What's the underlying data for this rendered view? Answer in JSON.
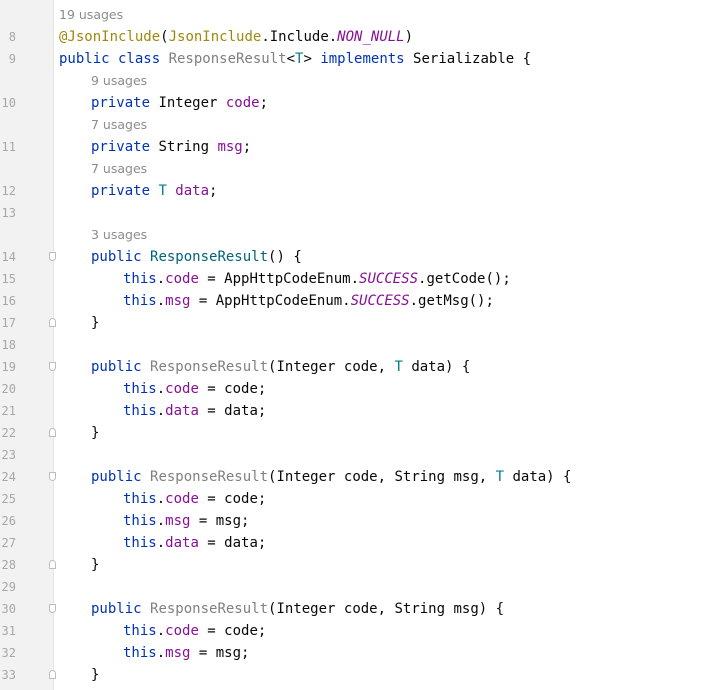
{
  "editor": {
    "lines": [
      {
        "kind": "hint",
        "indent": 0,
        "text": "19 usages"
      },
      {
        "kind": "code",
        "num": "8",
        "indent": 0,
        "tokens": [
          {
            "t": "@JsonInclude",
            "c": "ann"
          },
          {
            "t": "(",
            "c": ""
          },
          {
            "t": "JsonInclude",
            "c": "ann"
          },
          {
            "t": ".Include.",
            "c": ""
          },
          {
            "t": "NON_NULL",
            "c": "static-field"
          },
          {
            "t": ")",
            "c": ""
          }
        ]
      },
      {
        "kind": "code",
        "num": "9",
        "indent": 0,
        "tokens": [
          {
            "t": "public class ",
            "c": "kw"
          },
          {
            "t": "ResponseResult",
            "c": "gray"
          },
          {
            "t": "<",
            "c": ""
          },
          {
            "t": "T",
            "c": "tp"
          },
          {
            "t": "> ",
            "c": ""
          },
          {
            "t": "implements ",
            "c": "kw"
          },
          {
            "t": "Serializable {",
            "c": ""
          }
        ]
      },
      {
        "kind": "hint",
        "indent": 1,
        "text": "9 usages"
      },
      {
        "kind": "code",
        "num": "10",
        "indent": 1,
        "tokens": [
          {
            "t": "private ",
            "c": "kw"
          },
          {
            "t": "Integer ",
            "c": ""
          },
          {
            "t": "code",
            "c": "field"
          },
          {
            "t": ";",
            "c": ""
          }
        ]
      },
      {
        "kind": "hint",
        "indent": 1,
        "text": "7 usages"
      },
      {
        "kind": "code",
        "num": "11",
        "indent": 1,
        "tokens": [
          {
            "t": "private ",
            "c": "kw"
          },
          {
            "t": "String ",
            "c": ""
          },
          {
            "t": "msg",
            "c": "field"
          },
          {
            "t": ";",
            "c": ""
          }
        ]
      },
      {
        "kind": "hint",
        "indent": 1,
        "text": "7 usages"
      },
      {
        "kind": "code",
        "num": "12",
        "indent": 1,
        "tokens": [
          {
            "t": "private ",
            "c": "kw"
          },
          {
            "t": "T ",
            "c": "tp"
          },
          {
            "t": "data",
            "c": "field"
          },
          {
            "t": ";",
            "c": ""
          }
        ]
      },
      {
        "kind": "code",
        "num": "13",
        "indent": 0,
        "tokens": []
      },
      {
        "kind": "hint",
        "indent": 1,
        "text": "3 usages"
      },
      {
        "kind": "code",
        "num": "14",
        "indent": 1,
        "fold": "start",
        "tokens": [
          {
            "t": "public ",
            "c": "kw"
          },
          {
            "t": "ResponseResult",
            "c": "method-decl"
          },
          {
            "t": "() {",
            "c": ""
          }
        ]
      },
      {
        "kind": "code",
        "num": "15",
        "indent": 2,
        "tokens": [
          {
            "t": "this",
            "c": "kw"
          },
          {
            "t": ".",
            "c": ""
          },
          {
            "t": "code",
            "c": "field"
          },
          {
            "t": " = AppHttpCodeEnum.",
            "c": ""
          },
          {
            "t": "SUCCESS",
            "c": "static-field"
          },
          {
            "t": ".getCode();",
            "c": ""
          }
        ]
      },
      {
        "kind": "code",
        "num": "16",
        "indent": 2,
        "tokens": [
          {
            "t": "this",
            "c": "kw"
          },
          {
            "t": ".",
            "c": ""
          },
          {
            "t": "msg",
            "c": "field"
          },
          {
            "t": " = AppHttpCodeEnum.",
            "c": ""
          },
          {
            "t": "SUCCESS",
            "c": "static-field"
          },
          {
            "t": ".getMsg();",
            "c": ""
          }
        ]
      },
      {
        "kind": "code",
        "num": "17",
        "indent": 1,
        "fold": "end",
        "tokens": [
          {
            "t": "}",
            "c": ""
          }
        ]
      },
      {
        "kind": "code",
        "num": "18",
        "indent": 0,
        "tokens": []
      },
      {
        "kind": "code",
        "num": "19",
        "indent": 1,
        "fold": "start",
        "tokens": [
          {
            "t": "public ",
            "c": "kw"
          },
          {
            "t": "ResponseResult",
            "c": "gray"
          },
          {
            "t": "(Integer code, ",
            "c": ""
          },
          {
            "t": "T ",
            "c": "tp"
          },
          {
            "t": "data) {",
            "c": ""
          }
        ]
      },
      {
        "kind": "code",
        "num": "20",
        "indent": 2,
        "tokens": [
          {
            "t": "this",
            "c": "kw"
          },
          {
            "t": ".",
            "c": ""
          },
          {
            "t": "code",
            "c": "field"
          },
          {
            "t": " = code;",
            "c": ""
          }
        ]
      },
      {
        "kind": "code",
        "num": "21",
        "indent": 2,
        "tokens": [
          {
            "t": "this",
            "c": "kw"
          },
          {
            "t": ".",
            "c": ""
          },
          {
            "t": "data",
            "c": "field"
          },
          {
            "t": " = data;",
            "c": ""
          }
        ]
      },
      {
        "kind": "code",
        "num": "22",
        "indent": 1,
        "fold": "end",
        "tokens": [
          {
            "t": "}",
            "c": ""
          }
        ]
      },
      {
        "kind": "code",
        "num": "23",
        "indent": 0,
        "tokens": []
      },
      {
        "kind": "code",
        "num": "24",
        "indent": 1,
        "fold": "start",
        "tokens": [
          {
            "t": "public ",
            "c": "kw"
          },
          {
            "t": "ResponseResult",
            "c": "gray"
          },
          {
            "t": "(Integer code, String msg, ",
            "c": ""
          },
          {
            "t": "T ",
            "c": "tp"
          },
          {
            "t": "data) {",
            "c": ""
          }
        ]
      },
      {
        "kind": "code",
        "num": "25",
        "indent": 2,
        "tokens": [
          {
            "t": "this",
            "c": "kw"
          },
          {
            "t": ".",
            "c": ""
          },
          {
            "t": "code",
            "c": "field"
          },
          {
            "t": " = code;",
            "c": ""
          }
        ]
      },
      {
        "kind": "code",
        "num": "26",
        "indent": 2,
        "tokens": [
          {
            "t": "this",
            "c": "kw"
          },
          {
            "t": ".",
            "c": ""
          },
          {
            "t": "msg",
            "c": "field"
          },
          {
            "t": " = msg;",
            "c": ""
          }
        ]
      },
      {
        "kind": "code",
        "num": "27",
        "indent": 2,
        "tokens": [
          {
            "t": "this",
            "c": "kw"
          },
          {
            "t": ".",
            "c": ""
          },
          {
            "t": "data",
            "c": "field"
          },
          {
            "t": " = data;",
            "c": ""
          }
        ]
      },
      {
        "kind": "code",
        "num": "28",
        "indent": 1,
        "fold": "end",
        "tokens": [
          {
            "t": "}",
            "c": ""
          }
        ]
      },
      {
        "kind": "code",
        "num": "29",
        "indent": 0,
        "tokens": []
      },
      {
        "kind": "code",
        "num": "30",
        "indent": 1,
        "fold": "start",
        "tokens": [
          {
            "t": "public ",
            "c": "kw"
          },
          {
            "t": "ResponseResult",
            "c": "gray"
          },
          {
            "t": "(Integer code, String msg) {",
            "c": ""
          }
        ]
      },
      {
        "kind": "code",
        "num": "31",
        "indent": 2,
        "tokens": [
          {
            "t": "this",
            "c": "kw"
          },
          {
            "t": ".",
            "c": ""
          },
          {
            "t": "code",
            "c": "field"
          },
          {
            "t": " = code;",
            "c": ""
          }
        ]
      },
      {
        "kind": "code",
        "num": "32",
        "indent": 2,
        "tokens": [
          {
            "t": "this",
            "c": "kw"
          },
          {
            "t": ".",
            "c": ""
          },
          {
            "t": "msg",
            "c": "field"
          },
          {
            "t": " = msg;",
            "c": ""
          }
        ]
      },
      {
        "kind": "code",
        "num": "33",
        "indent": 1,
        "fold": "end",
        "tokens": [
          {
            "t": "}",
            "c": ""
          }
        ]
      }
    ]
  },
  "colors": {
    "keyword": "#0033b3",
    "annotation": "#9e880d",
    "field": "#871094",
    "type_param": "#007e8a",
    "unused": "#808080",
    "method_declaration": "#00627a",
    "line_number": "#a7a7a7",
    "hint": "#8c8c8c"
  }
}
